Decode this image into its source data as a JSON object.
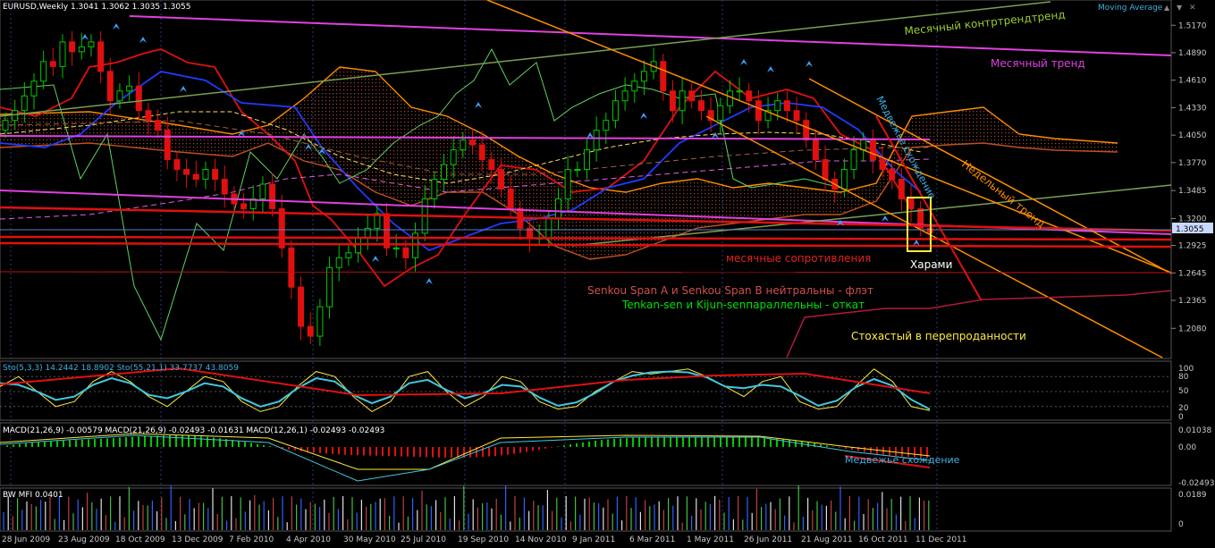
{
  "window": {
    "symbol_header": "EURUSD,Weekly  1.3041 1.3062 1.3035 1.3055",
    "indicator_header": "Moving Average",
    "controls": {
      "up": "▲",
      "down": "▼",
      "close": "✕"
    }
  },
  "price_axis": {
    "ticks": [
      "1.5170",
      "1.4890",
      "1.4610",
      "1.4330",
      "1.4050",
      "1.3770",
      "1.3485",
      "1.3200",
      "1.2925",
      "1.2645",
      "1.2365",
      "1.2080"
    ],
    "current_price": "1.3055"
  },
  "annotations": {
    "monthly_countertrend": "Месячный контртрендтренд",
    "monthly_trend": "Месячный тренд",
    "medium_decline": "Медвежье схождение",
    "weekly_trend": "Недельный тренд",
    "harami": "Харами",
    "monthly_resistances": "месячные сопротивления",
    "senkou_note": "Senkou Span A и Senkou Span B нейтральны - флэт",
    "tenkan_note": "Tenkan-sen и Kijun-senпараллельны - откат",
    "stoch_note": "Стохастый в перепроданности",
    "macd_note": "Медвежье схождение"
  },
  "stoch_panel": {
    "header": "Sto(5,3,3) 14.2442 18.8902  Sto(55,21,1) 33.7737 43.8059",
    "ticks": [
      "100",
      "80",
      "50",
      "20",
      "0"
    ]
  },
  "macd_panel": {
    "header": "MACD(21,26,9) -0.00579 MACD(21,26,9) -0.02493 -0.01631  MACD(12,26,1) -0.02493 -0.02493",
    "ticks": [
      "0.01038",
      "0.00",
      "-0.02493"
    ]
  },
  "mfi_panel": {
    "header": "BW MFI 0.0401",
    "ticks": [
      "0.0189",
      "0"
    ]
  },
  "time_axis": [
    "28 Jun 2009",
    "23 Aug 2009",
    "18 Oct 2009",
    "13 Dec 2009",
    "7 Feb 2010",
    "4 Apr 2010",
    "30 May 2010",
    "25 Jul 2010",
    "19 Sep 2010",
    "14 Nov 2010",
    "9 Jan 2011",
    "6 Mar 2011",
    "1 May 2011",
    "26 Jun 2011",
    "21 Aug 2011",
    "16 Oct 2011",
    "11 Dec 2011"
  ],
  "colors": {
    "background": "#000000",
    "bull": "#00c800",
    "bear": "#e01010",
    "magenta": "#e040e0",
    "orange": "#ff8c00",
    "yellow": "#ffeb3b",
    "green_line": "#9acd32",
    "blue": "#1f3bff",
    "cyan": "#40c8e0"
  },
  "chart_data": {
    "type": "candlestick",
    "symbol": "EURUSD",
    "timeframe": "Weekly",
    "last_bar": {
      "open": 1.3041,
      "high": 1.3062,
      "low": 1.3035,
      "close": 1.3055
    },
    "ylim": [
      1.18,
      1.53
    ],
    "x_categories": [
      "28 Jun 2009",
      "23 Aug 2009",
      "18 Oct 2009",
      "13 Dec 2009",
      "7 Feb 2010",
      "4 Apr 2010",
      "30 May 2010",
      "25 Jul 2010",
      "19 Sep 2010",
      "14 Nov 2010",
      "9 Jan 2011",
      "6 Mar 2011",
      "1 May 2011",
      "26 Jun 2011",
      "21 Aug 2011",
      "16 Oct 2011",
      "11 Dec 2011"
    ],
    "close": [
      1.42,
      1.43,
      1.445,
      1.46,
      1.48,
      1.475,
      1.5,
      1.49,
      1.495,
      1.5,
      1.47,
      1.44,
      1.45,
      1.455,
      1.43,
      1.42,
      1.41,
      1.38,
      1.37,
      1.365,
      1.36,
      1.37,
      1.36,
      1.345,
      1.335,
      1.33,
      1.34,
      1.355,
      1.33,
      1.29,
      1.25,
      1.21,
      1.2,
      1.23,
      1.27,
      1.28,
      1.285,
      1.3,
      1.31,
      1.325,
      1.29,
      1.29,
      1.28,
      1.305,
      1.34,
      1.36,
      1.375,
      1.39,
      1.4,
      1.395,
      1.38,
      1.37,
      1.35,
      1.33,
      1.31,
      1.3,
      1.3,
      1.32,
      1.34,
      1.37,
      1.37,
      1.39,
      1.41,
      1.42,
      1.44,
      1.45,
      1.46,
      1.47,
      1.48,
      1.45,
      1.43,
      1.45,
      1.44,
      1.43,
      1.42,
      1.435,
      1.45,
      1.45,
      1.44,
      1.42,
      1.43,
      1.44,
      1.43,
      1.42,
      1.4,
      1.38,
      1.36,
      1.35,
      1.37,
      1.39,
      1.4,
      1.38,
      1.37,
      1.36,
      1.34,
      1.33,
      1.31,
      1.3055
    ],
    "lines": {
      "monthly_trend": "magenta descending line from top-left to right",
      "monthly_countertrend": "green ascending line",
      "weekly_trend": "orange descending channel"
    },
    "stoch_ylim": [
      0,
      100
    ],
    "macd_ylim": [
      -0.03,
      0.012
    ]
  }
}
